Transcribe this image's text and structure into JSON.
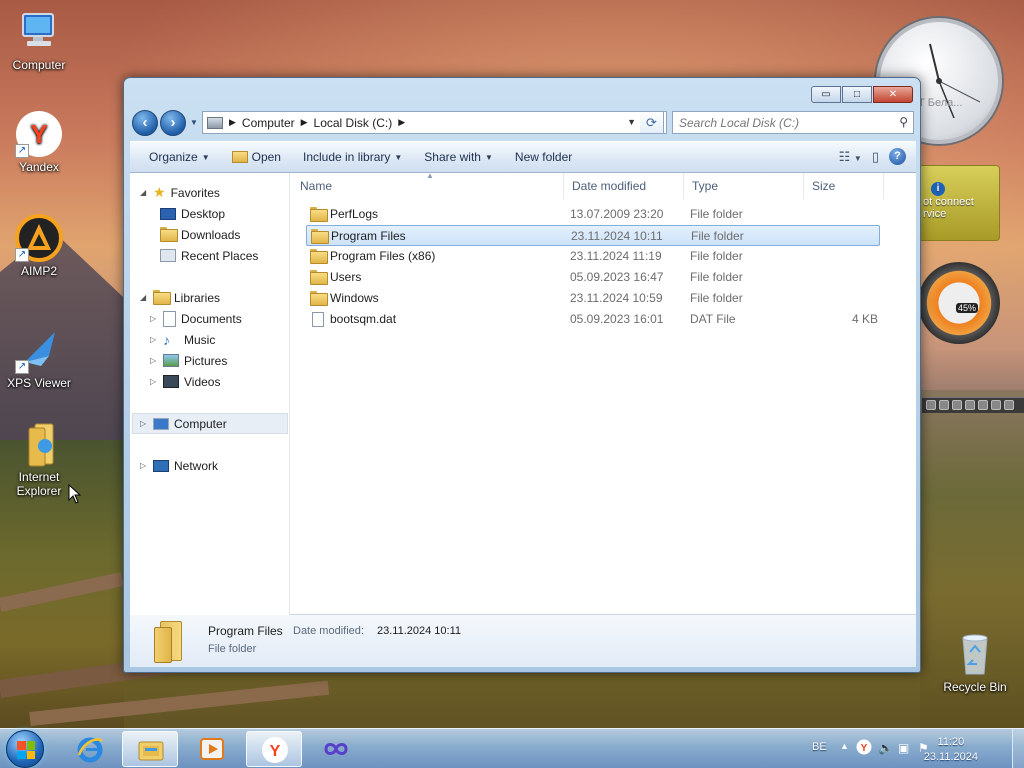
{
  "desktop": {
    "icons": [
      {
        "label": "Computer",
        "icon": "computer-icon"
      },
      {
        "label": "Yandex",
        "icon": "yandex-icon"
      },
      {
        "label": "AIMP2",
        "icon": "aimp-icon"
      },
      {
        "label": "XPS Viewer",
        "icon": "xps-viewer-icon"
      },
      {
        "label": "Internet Explorer",
        "icon": "folder-ie-icon"
      },
      {
        "label": "Recycle Bin",
        "icon": "recycle-bin-icon"
      }
    ]
  },
  "gadgets": {
    "clock_partial_text": "Т Бела...",
    "weather_text": "ot connect rvice",
    "meter_percent": "45%"
  },
  "window": {
    "controls": {
      "minimize": "▭",
      "maximize": "□",
      "close": "✕"
    },
    "breadcrumb": [
      "Computer",
      "Local Disk (C:)"
    ],
    "search_placeholder": "Search Local Disk (C:)",
    "toolbar": {
      "organize": "Organize",
      "open": "Open",
      "include_in_library": "Include in library",
      "share_with": "Share with",
      "new_folder": "New folder"
    },
    "nav": {
      "favorites": "Favorites",
      "desktop": "Desktop",
      "downloads": "Downloads",
      "recent_places": "Recent Places",
      "libraries": "Libraries",
      "documents": "Documents",
      "music": "Music",
      "pictures": "Pictures",
      "videos": "Videos",
      "computer": "Computer",
      "network": "Network"
    },
    "columns": {
      "name": "Name",
      "date_modified": "Date modified",
      "type": "Type",
      "size": "Size"
    },
    "files": [
      {
        "name": "PerfLogs",
        "date": "13.07.2009 23:20",
        "type": "File folder",
        "size": "",
        "kind": "folder"
      },
      {
        "name": "Program Files",
        "date": "23.11.2024 10:11",
        "type": "File folder",
        "size": "",
        "kind": "folder",
        "selected": true
      },
      {
        "name": "Program Files (x86)",
        "date": "23.11.2024 11:19",
        "type": "File folder",
        "size": "",
        "kind": "folder"
      },
      {
        "name": "Users",
        "date": "05.09.2023 16:47",
        "type": "File folder",
        "size": "",
        "kind": "folder"
      },
      {
        "name": "Windows",
        "date": "23.11.2024 10:59",
        "type": "File folder",
        "size": "",
        "kind": "folder"
      },
      {
        "name": "bootsqm.dat",
        "date": "05.09.2023 16:01",
        "type": "DAT File",
        "size": "4 KB",
        "kind": "file"
      }
    ],
    "details": {
      "name": "Program Files",
      "date_label": "Date modified:",
      "date_value": "23.11.2024 10:11",
      "type": "File folder"
    }
  },
  "taskbar": {
    "language": "BE",
    "time": "11:20",
    "date": "23.11.2024"
  }
}
